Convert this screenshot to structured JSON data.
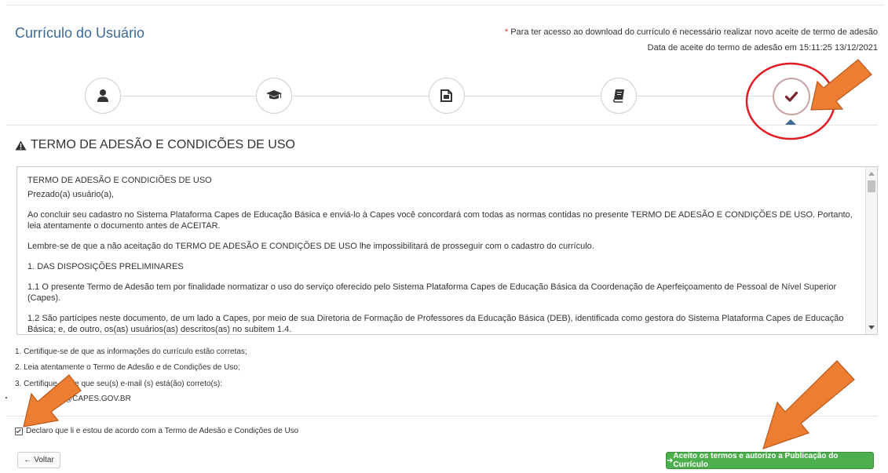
{
  "header": {
    "title": "Currículo do Usuário",
    "notice_asterisk": "*",
    "notice": "Para ter acesso ao download do currículo é necessário realizar novo aceite de termo de adesão",
    "accept_date": "Data de aceite do termo de adesão em 15:11:25 13/12/2021"
  },
  "steps": [
    {
      "icon": "user-icon",
      "active": false
    },
    {
      "icon": "graduation-cap-icon",
      "active": false
    },
    {
      "icon": "document-icon",
      "active": false
    },
    {
      "icon": "book-icon",
      "active": false
    },
    {
      "icon": "checkmark-icon",
      "active": true
    }
  ],
  "section": {
    "title": "TERMO DE ADESÃO E CONDICÕES DE USO"
  },
  "term": {
    "paragraphs": [
      "TERMO DE ADESÃO E CONDICIÕES DE USO",
      "Prezado(a) usuário(a),",
      "Ao concluir seu cadastro no Sistema Plataforma Capes de Educação Básica e enviá-lo à Capes você concordará com todas as normas contidas no presente TERMO DE ADESÃO E CONDIÇÕES DE USO. Portanto, leia atentamente o documento antes de ACEITAR.",
      "Lembre-se de que a não aceitação do TERMO DE ADESÃO E CONDIÇÕES DE USO lhe impossibilitará de prosseguir com o cadastro do currículo.",
      "1. DAS DISPOSIÇÕES PRELIMINARES",
      "1.1 O presente Termo de Adesão tem por finalidade normatizar o uso do serviço oferecido pelo Sistema Plataforma Capes de Educação Básica da Coordenação de Aperfeiçoamento de Pessoal de Nível Superior (Capes).",
      "1.2 São partícipes neste documento, de um lado a Capes, por meio de sua Diretoria de Formação de Professores da Educação Básica (DEB), identificada como gestora do Sistema Plataforma Capes de Educação Básica; e, de outro, os(as) usuários(as) descritos(as) no subitem 1.4."
    ]
  },
  "instructions": {
    "item1": "1. Certifique-se de que as informações do currículo estão corretas;",
    "item2": "2. Leia atentamente o Termo de Adesão e de Condições de Uso;",
    "item3": "3. Certifique-se de que seu(s) e-mail (s) está(ão) correto(s):",
    "email": "@CAPES.GOV.BR"
  },
  "declare": {
    "label": "Declaro que li e estou de acordo com a Termo de Adesão e Condições de Uso",
    "checked": true
  },
  "buttons": {
    "back": "Voltar",
    "back_arrow": "←",
    "accept_arrow": "➜",
    "accept": "Aceito os termos e autorizo a Publicação do Currículo"
  },
  "colors": {
    "title_blue": "#3d6b96",
    "accept_green": "#4cae4c",
    "check_maroon": "#7b2430",
    "annotation_red": "#e31b23",
    "annotation_orange": "#ed7d31"
  }
}
